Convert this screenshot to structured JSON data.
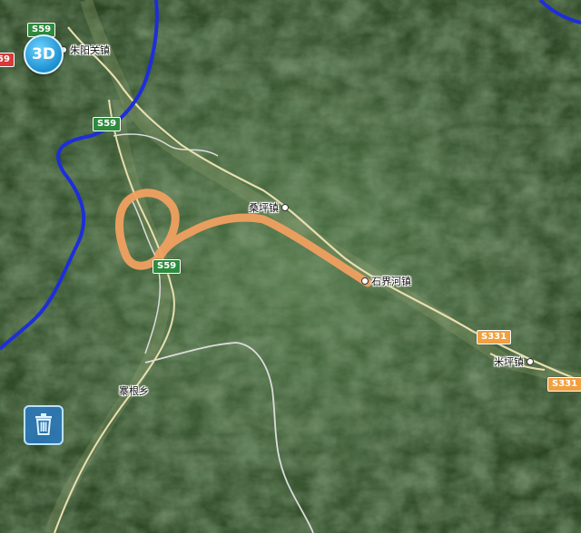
{
  "map": {
    "places": [
      {
        "label": "朱阳关镇"
      },
      {
        "label": "桑坪镇"
      },
      {
        "label": "石界河镇"
      },
      {
        "label": "米坪镇"
      },
      {
        "label": "寨根乡"
      }
    ],
    "road_shields": [
      {
        "label": "S59",
        "kind": "green"
      },
      {
        "label": "S59",
        "kind": "green"
      },
      {
        "label": "S59",
        "kind": "green"
      },
      {
        "label": "S331",
        "kind": "orange"
      },
      {
        "label": "S331",
        "kind": "orange"
      },
      {
        "label": "59",
        "kind": "red"
      }
    ]
  },
  "controls": {
    "mode_3d_label": "3D",
    "trash_icon": "trash-icon"
  },
  "colors": {
    "route": "#f0a060",
    "boundary": "#1e2ed8",
    "road": "#e8dfb0",
    "river": "#dcdcdc"
  }
}
